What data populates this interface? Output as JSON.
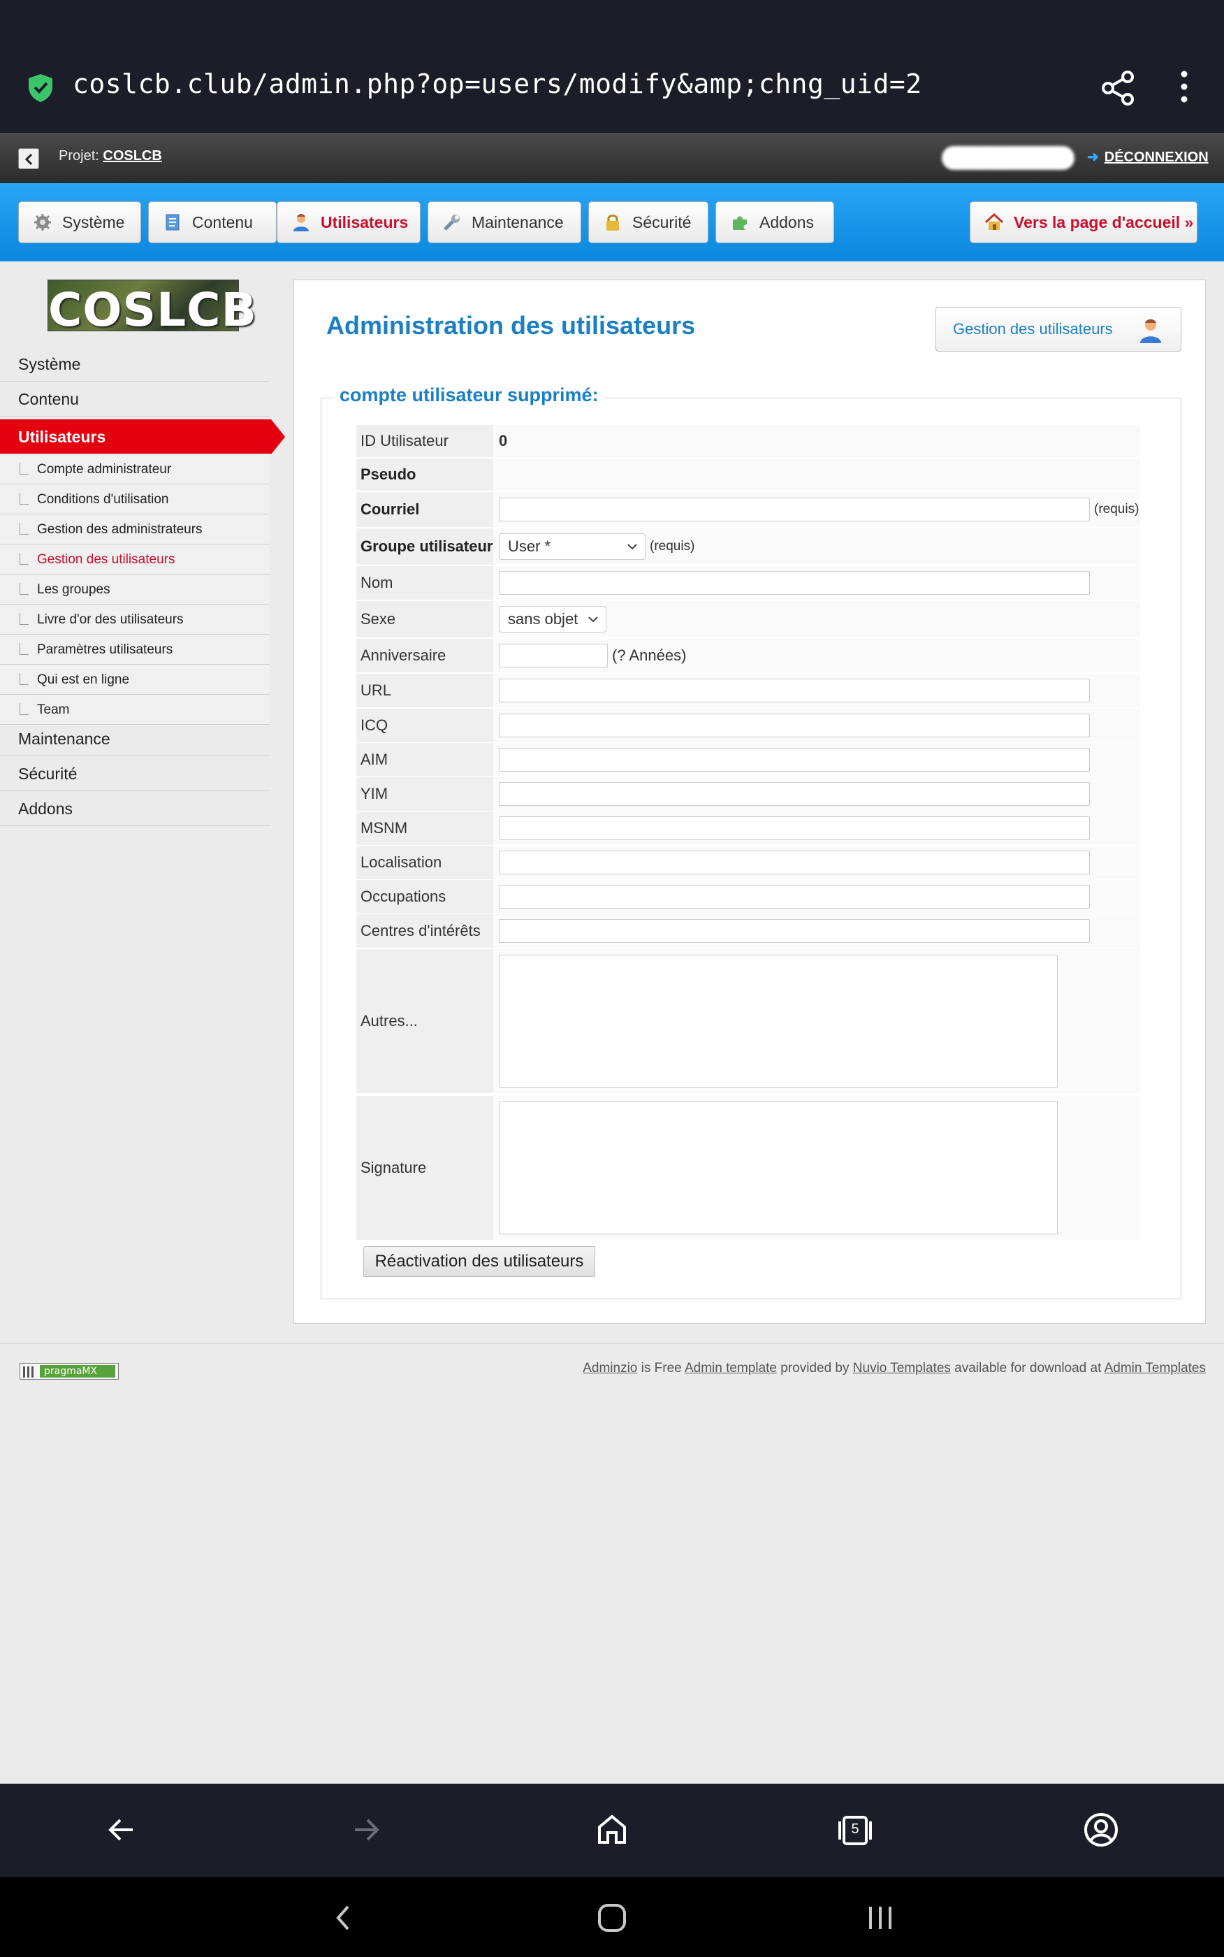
{
  "browser": {
    "url": "coslcb.club/admin.php?op=users/modify&amp;chng_uid=2",
    "tabs_count": "5"
  },
  "project_bar": {
    "project_label": "Projet:",
    "project_name": "COSLCB",
    "logout_label": "DÉCONNEXION"
  },
  "main_nav": {
    "items": [
      {
        "label": "Système",
        "icon": "gear-icon"
      },
      {
        "label": "Contenu",
        "icon": "document-icon"
      },
      {
        "label": "Utilisateurs",
        "icon": "user-icon"
      },
      {
        "label": "Maintenance",
        "icon": "wrench-icon"
      },
      {
        "label": "Sécurité",
        "icon": "lock-icon"
      },
      {
        "label": "Addons",
        "icon": "puzzle-icon"
      }
    ],
    "active": "Utilisateurs",
    "home_label": "Vers la page d'accueil »"
  },
  "sidebar": {
    "logo_text": "COSLCB",
    "items": [
      {
        "label": "Système"
      },
      {
        "label": "Contenu"
      },
      {
        "label": "Utilisateurs"
      },
      {
        "label": "Maintenance"
      },
      {
        "label": "Sécurité"
      },
      {
        "label": "Addons"
      }
    ],
    "subitems": [
      {
        "label": "Compte administrateur"
      },
      {
        "label": "Conditions d'utilisation"
      },
      {
        "label": "Gestion des administrateurs"
      },
      {
        "label": "Gestion des utilisateurs"
      },
      {
        "label": "Les groupes"
      },
      {
        "label": "Livre d'or des utilisateurs"
      },
      {
        "label": "Paramètres utilisateurs"
      },
      {
        "label": "Qui est en ligne"
      },
      {
        "label": "Team"
      }
    ]
  },
  "content": {
    "title": "Administration des utilisateurs",
    "manage_button": "Gestion des utilisateurs",
    "legend": "compte utilisateur supprimé:",
    "fields": {
      "id_label": "ID Utilisateur",
      "id_value": "0",
      "pseudo_label": "Pseudo",
      "email_label": "Courriel",
      "required_note": "(requis)",
      "group_label": "Groupe utilisateur",
      "group_value": "User *",
      "name_label": "Nom",
      "sex_label": "Sexe",
      "sex_value": "sans objet",
      "birthday_label": "Anniversaire",
      "birthday_note": "(? Années)",
      "url_label": "URL",
      "icq_label": "ICQ",
      "aim_label": "AIM",
      "yim_label": "YIM",
      "msnm_label": "MSNM",
      "location_label": "Localisation",
      "occupation_label": "Occupations",
      "interests_label": "Centres d'intérêts",
      "other_label": "Autres...",
      "signature_label": "Signature"
    },
    "reactivate_button": "Réactivation des utilisateurs"
  },
  "footer": {
    "badge_text": "pragmaMX",
    "credit_1": "Adminzio",
    "credit_2": " is Free ",
    "credit_3": "Admin template",
    "credit_4": " provided by ",
    "credit_5": "Nuvio Templates",
    "credit_6": " available for download at ",
    "credit_7": "Admin Templates"
  },
  "colors": {
    "accent_blue": "#1a7fc4",
    "nav_blue": "#0a87de",
    "active_red": "#e4000f"
  }
}
